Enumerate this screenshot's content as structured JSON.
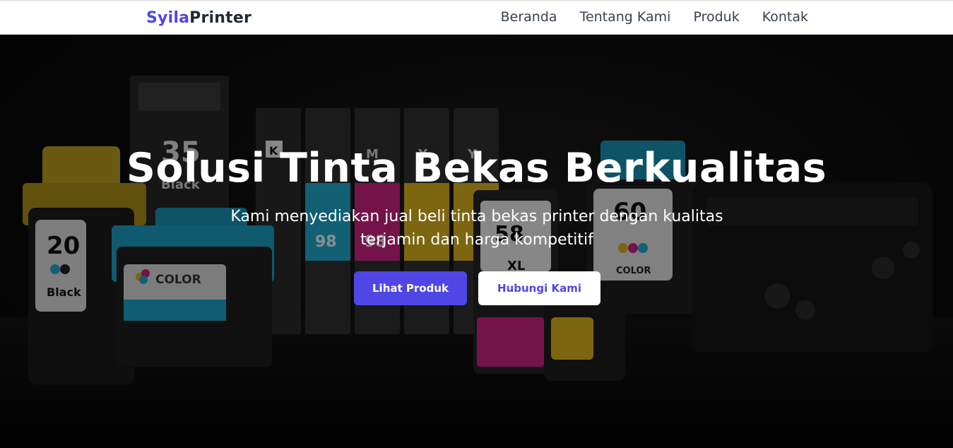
{
  "navbar": {
    "brand_part1": "Syila",
    "brand_part2": "Printer",
    "links": [
      {
        "label": "Beranda"
      },
      {
        "label": "Tentang Kami"
      },
      {
        "label": "Produk"
      },
      {
        "label": "Kontak"
      }
    ]
  },
  "hero": {
    "title": "Solusi Tinta Bekas Berkualitas",
    "subtitle": "Kami menyediakan jual beli tinta bekas printer dengan kualitas terjamin dan harga kompetitif",
    "primary_button": "Lihat Produk",
    "secondary_button": "Hubungi Kami"
  },
  "background_image": {
    "cartridges": [
      {
        "number": "20",
        "label": "Black"
      },
      {
        "number": "35",
        "label": "Black"
      },
      {
        "label": "COLOR"
      },
      {
        "label": "K"
      },
      {
        "number": "98"
      },
      {
        "number": "98"
      },
      {
        "label": "M"
      },
      {
        "label": "Y"
      },
      {
        "label": "Y"
      },
      {
        "number": "58",
        "label": "XL"
      },
      {
        "number": "60",
        "label": "COLOR"
      }
    ]
  },
  "colors": {
    "accent": "#4f46e5",
    "brand_dark": "#1f2937",
    "nav_text": "#374151",
    "cyan": "#1fa6c9",
    "magenta": "#c8227e",
    "yellow": "#d8b01c"
  }
}
